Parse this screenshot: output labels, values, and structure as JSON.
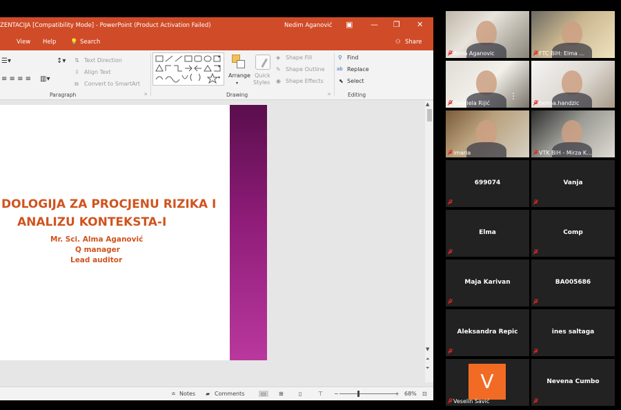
{
  "ppt": {
    "title": "ZENTACIJA [Compatibility Mode]  -  PowerPoint (Product Activation Failed)",
    "user": "Nedim Aganović",
    "menu": {
      "view": "View",
      "help": "Help",
      "search": "Search",
      "share": "Share"
    },
    "ribbon": {
      "text_direction": "Text Direction",
      "align_text": "Align Text",
      "convert_smartart": "Convert to SmartArt",
      "paragraph": "Paragraph",
      "arrange": "Arrange",
      "quick_styles_1": "Quick",
      "quick_styles_2": "Styles",
      "shape_fill": "Shape Fill",
      "shape_outline": "Shape Outline",
      "shape_effects": "Shape Effects",
      "drawing": "Drawing",
      "find": "Find",
      "replace": "Replace",
      "select": "Select",
      "editing": "Editing"
    },
    "slide": {
      "title_line1": "DOLOGIJA ZA PROCJENU RIZIKA I",
      "title_line2": "ANALIZU KONTEKSTA-I",
      "author": "Mr. Sci. Alma Aganović",
      "role1": "Q manager",
      "role2": "Lead auditor"
    },
    "status": {
      "notes": "Notes",
      "comments": "Comments",
      "zoom": "68%"
    }
  },
  "participants": [
    {
      "name": "Alma Aganovic",
      "video": true
    },
    {
      "name": "FTC BiH: Elma ...",
      "video": true
    },
    {
      "name": "Gabriela Rijić",
      "video": true
    },
    {
      "name": "belma.handzic",
      "video": true
    },
    {
      "name": "imaria",
      "video": true
    },
    {
      "name": "VTK BiH - Mirza K...",
      "video": true,
      "active": true
    },
    {
      "name": "699074"
    },
    {
      "name": "Vanja"
    },
    {
      "name": "Elma"
    },
    {
      "name": "Comp"
    },
    {
      "name": "Maja Karivan"
    },
    {
      "name": "BA005686"
    },
    {
      "name": "Aleksandra Repic"
    },
    {
      "name": "ines saltaga"
    },
    {
      "name": "Veselin Savić",
      "avatar_letter": "V"
    },
    {
      "name": "Nevena Cumbo"
    }
  ],
  "colors": {
    "ppt_orange": "#d04b27",
    "slide_text": "#d0531f",
    "avatar_orange": "#f26b24",
    "active_speaker": "#e8df7a",
    "muted_red": "#e0262b"
  }
}
